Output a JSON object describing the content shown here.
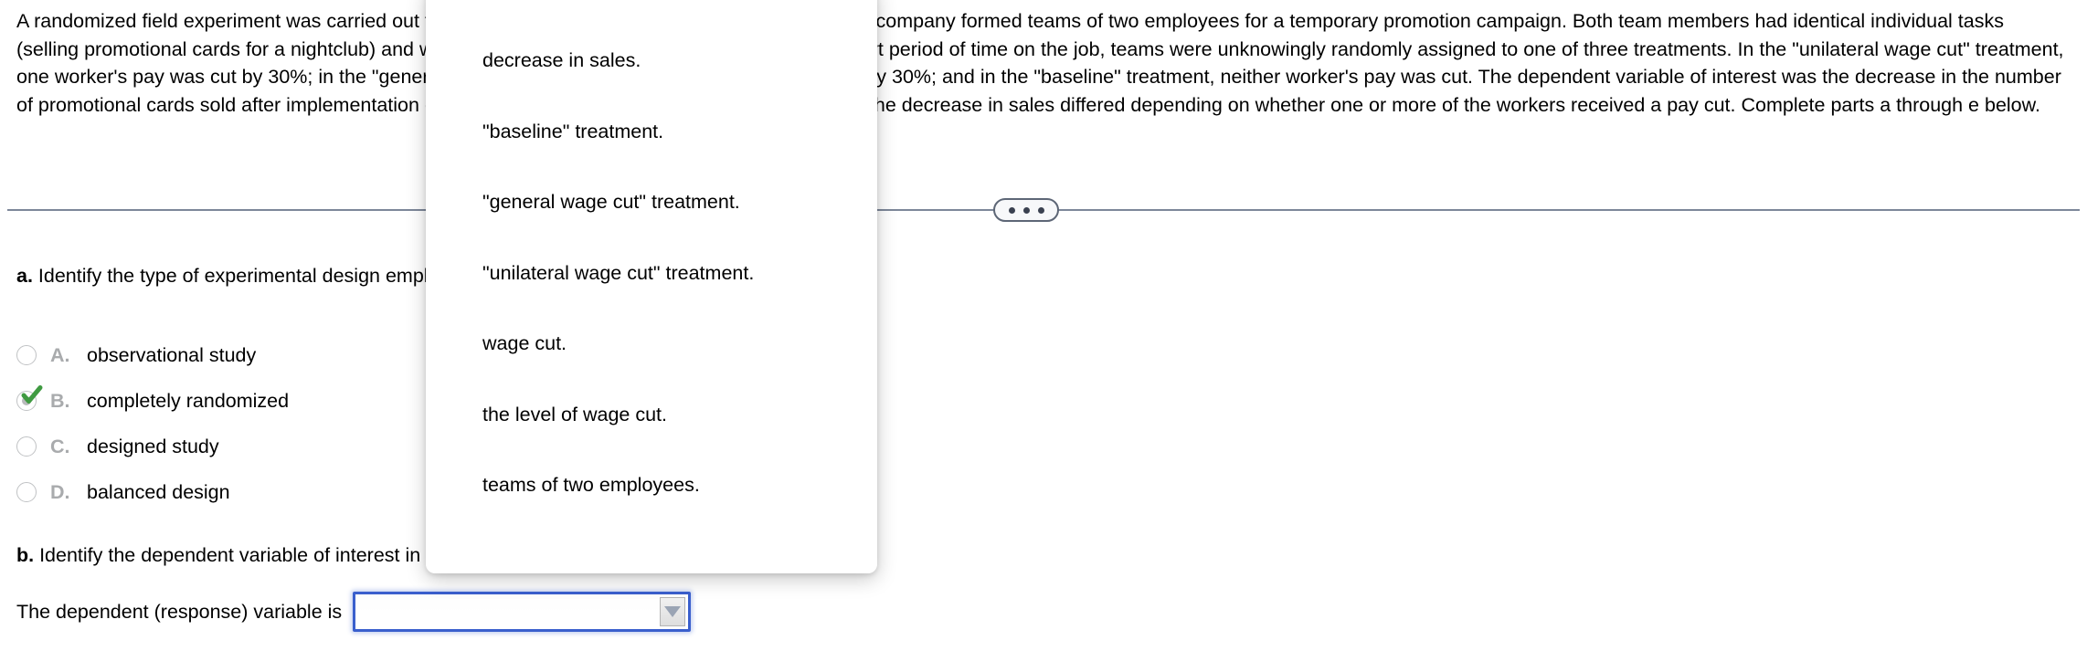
{
  "problem": {
    "statement": "A randomized field experiment was carried out to investigate how workers respond to wage cuts. A company formed teams of two employees for a temporary promotion campaign. Both team members had identical individual tasks (selling promotional cards for a nightclub) and were initially paid the same hourly wage. After a short period of time on the job, teams were unknowingly randomly assigned to one of three treatments. In the \"unilateral wage cut\" treatment, one worker's pay was cut by 30%; in the \"general wage cut\" treatment, both workers' pay was cut by 30%; and in the \"baseline\" treatment, neither worker's pay was cut. The dependent variable of interest was the decrease in the number of promotional cards sold after implementation of the pay cuts. The researchers wanted to know if the decrease in sales differed depending on whether one or more of the workers received a pay cut. Complete parts a through e below."
  },
  "divider": {
    "handle_dots": 3
  },
  "part_a": {
    "lead": "a.",
    "prompt": " Identify the type of experimental design employed in the study.",
    "selected_letter": "B",
    "choices": [
      {
        "letter": "A.",
        "text": "observational study",
        "selected": false
      },
      {
        "letter": "B.",
        "text": "completely randomized",
        "selected": true
      },
      {
        "letter": "C.",
        "text": "designed study",
        "selected": false
      },
      {
        "letter": "D.",
        "text": "balanced design",
        "selected": false
      }
    ]
  },
  "part_b": {
    "lead": "b.",
    "prompt": " Identify the dependent variable of interest in the study.",
    "answer_label": "The dependent (response) variable is",
    "answer_value": "",
    "answer_placeholder": ""
  },
  "dropdown": {
    "open": true,
    "options": [
      "decrease in sales.",
      "\"baseline\" treatment.",
      "\"general wage cut\" treatment.",
      "\"unilateral wage cut\" treatment.",
      "wage cut.",
      "the level of wage cut.",
      "teams of two employees."
    ]
  },
  "colors": {
    "focus_border": "#3a5fcd",
    "divider": "#7d8799",
    "check_green": "#3f9a41",
    "letter_gray": "#a9abad"
  }
}
